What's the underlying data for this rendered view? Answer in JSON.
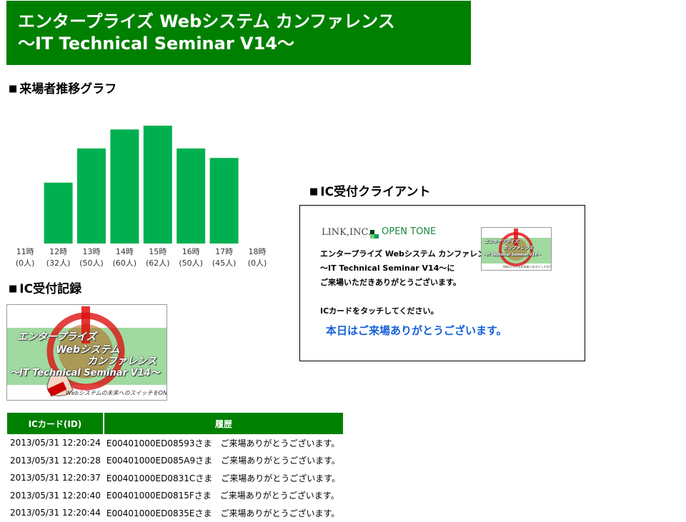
{
  "header": {
    "line1": "エンタープライズ Webシステム カンファレンス",
    "line2": "～IT Technical Seminar V14～"
  },
  "chart_section": {
    "title": "来場者推移グラフ",
    "marker": "■"
  },
  "chart_data": {
    "type": "bar",
    "categories": [
      "11時",
      "12時",
      "13時",
      "14時",
      "15時",
      "16時",
      "17時",
      "18時"
    ],
    "value_labels": [
      "(0人)",
      "(32人)",
      "(50人)",
      "(60人)",
      "(62人)",
      "(50人)",
      "(45人)",
      "(0人)"
    ],
    "values": [
      0,
      32,
      50,
      60,
      62,
      50,
      45,
      0
    ],
    "ylim": [
      0,
      62
    ],
    "color": "#00b050",
    "grid": false,
    "title": "",
    "xlabel": "",
    "ylabel": ""
  },
  "record_section": {
    "title": "IC受付記録",
    "marker": "■"
  },
  "logo": {
    "line1": "エンタープライズ",
    "line2": "Webシステム",
    "line3": "カンファレンス",
    "line4": "～IT Technical Seminar V14～",
    "tagline": "Webシステムの未来へのスイッチをON",
    "accent": "#cc0000",
    "band": "#7ec87e"
  },
  "table": {
    "headers": [
      "ICカード(ID)",
      "履歴"
    ],
    "rows": [
      [
        "2013/05/31 12:20:24",
        "E00401000ED08593さま　ご来場ありがとうございます。"
      ],
      [
        "2013/05/31 12:20:28",
        "E00401000ED085A9さま　ご来場ありがとうございます。"
      ],
      [
        "2013/05/31 12:20:37",
        "E00401000ED0831Cさま　ご来場ありがとうございます。"
      ],
      [
        "2013/05/31 12:20:40",
        "E00401000ED0815Fさま　ご来場ありがとうございます。"
      ],
      [
        "2013/05/31 12:20:44",
        "E00401000ED0835Eさま　ご来場ありがとうございます。"
      ]
    ]
  },
  "client_section": {
    "title": "IC受付クライアント",
    "marker": "■"
  },
  "client": {
    "brand_left": "LINK,INC.",
    "brand_right": "OPEN TONE",
    "msg1": "エンタープライズ Webシステム カンファレンス",
    "msg2": "～IT Technical Seminar V14～に",
    "msg3": "ご来場いただきありがとうございます。",
    "instruction": "ICカードをタッチしてください。",
    "status": "本日はご来場ありがとうございます。",
    "status_color": "#1560d8"
  },
  "colors": {
    "brand_green": "#008000",
    "bar_green": "#00b050"
  }
}
